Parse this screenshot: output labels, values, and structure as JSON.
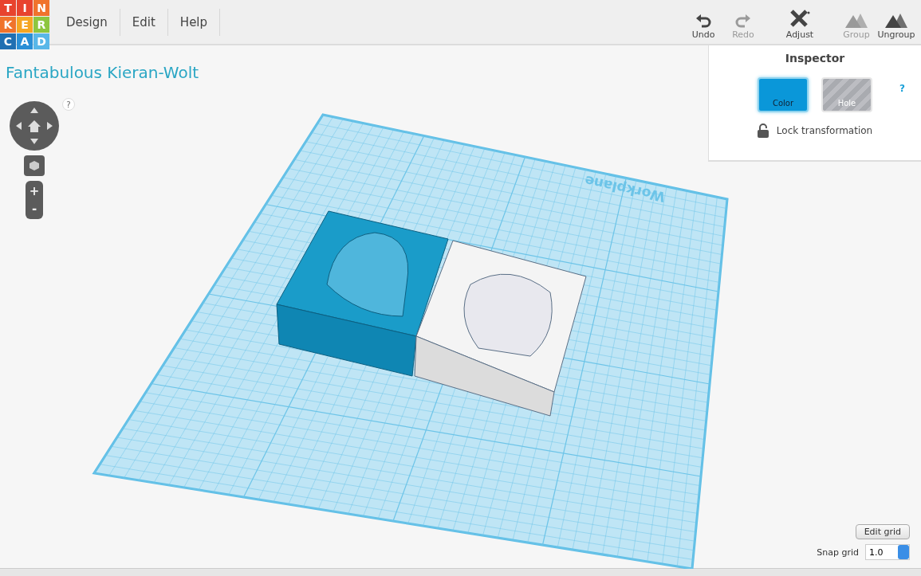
{
  "logo": {
    "letters": [
      {
        "char": "T",
        "color": "#e8432e"
      },
      {
        "char": "I",
        "color": "#e8432e"
      },
      {
        "char": "N",
        "color": "#f0732c"
      },
      {
        "char": "K",
        "color": "#f0732c"
      },
      {
        "char": "E",
        "color": "#f5a623"
      },
      {
        "char": "R",
        "color": "#8dc63f"
      },
      {
        "char": "C",
        "color": "#1f6fb2"
      },
      {
        "char": "A",
        "color": "#2a8fd6"
      },
      {
        "char": "D",
        "color": "#59b7e8"
      }
    ]
  },
  "menu": [
    {
      "label": "Design"
    },
    {
      "label": "Edit"
    },
    {
      "label": "Help"
    }
  ],
  "toolbar": [
    {
      "kind": "undo",
      "label": "Undo",
      "disabled": false
    },
    {
      "kind": "redo",
      "label": "Redo",
      "disabled": true
    },
    {
      "kind": "adjust",
      "label": "Adjust",
      "disabled": false
    },
    {
      "kind": "group",
      "label": "Group",
      "disabled": true
    },
    {
      "kind": "ungroup",
      "label": "Ungroup",
      "disabled": false
    }
  ],
  "design_title": "Fantabulous Kieran-Wolt",
  "view_controls": {
    "help": "?",
    "zoom_in": "+",
    "zoom_out": "-"
  },
  "workplane": {
    "label": "Workplane"
  },
  "inspector": {
    "title": "Inspector",
    "help": "?",
    "swatches": [
      {
        "label": "Color",
        "kind": "solid",
        "selected": true
      },
      {
        "label": "Hole",
        "kind": "hole",
        "selected": false
      }
    ],
    "lock": {
      "label": "Lock transformation",
      "locked": false
    }
  },
  "grid": {
    "edit_button": "Edit grid",
    "snap_label": "Snap grid",
    "snap_value": "1.0"
  }
}
